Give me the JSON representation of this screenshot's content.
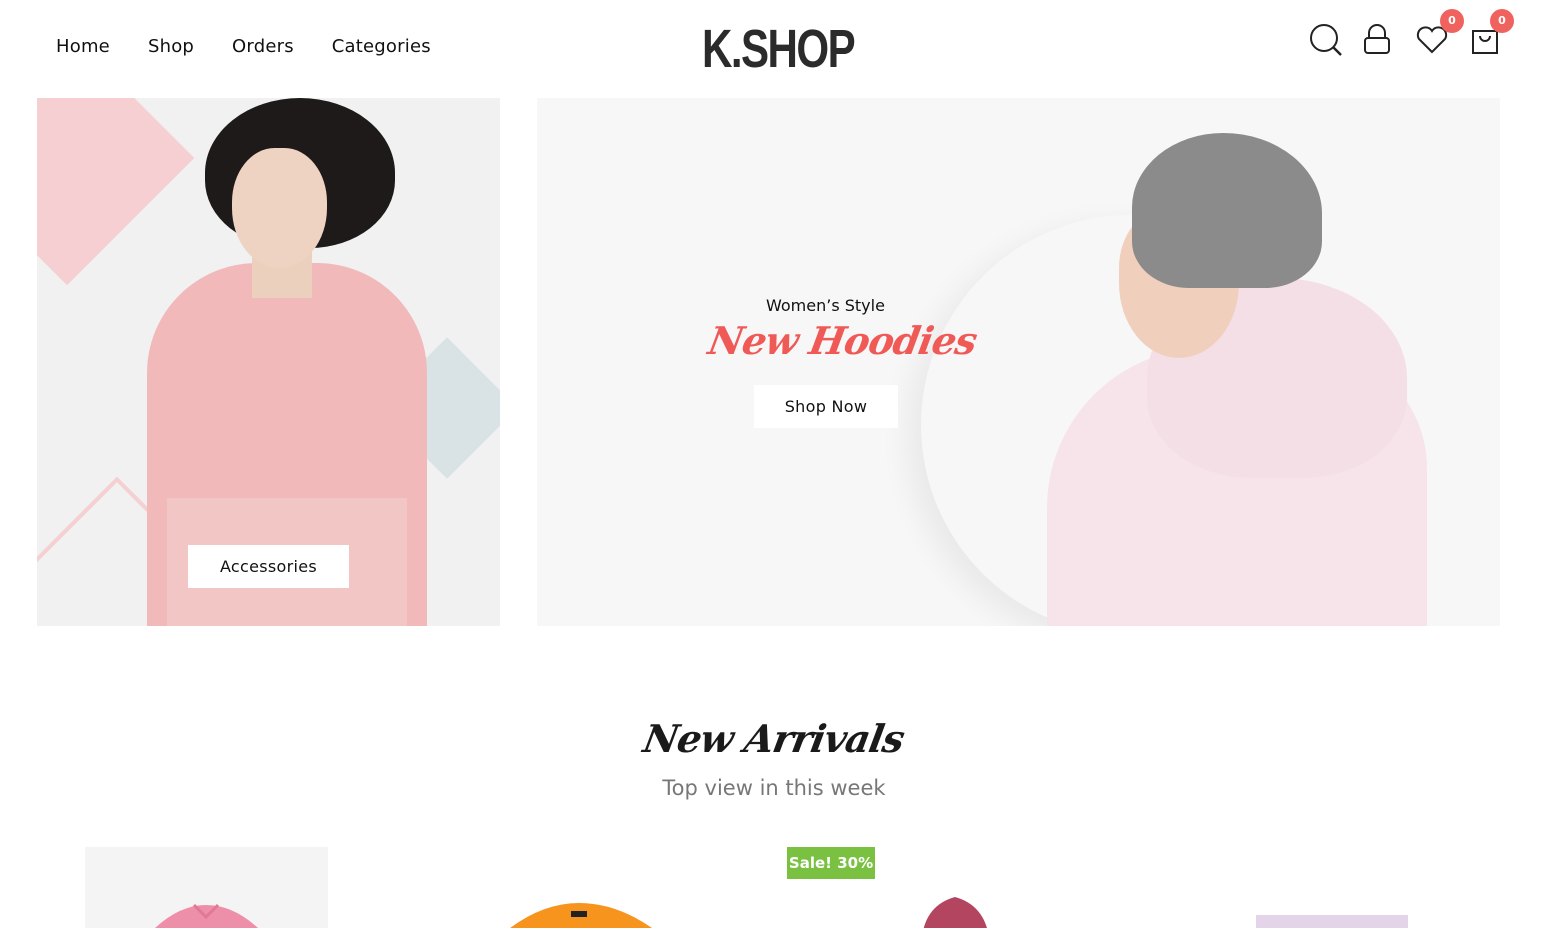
{
  "header": {
    "nav": [
      "Home",
      "Shop",
      "Orders",
      "Categories"
    ],
    "logo": "K.SHOP",
    "icons": [
      "search-icon",
      "lock-icon",
      "heart-icon",
      "bag-icon"
    ],
    "wishlist_count": "0",
    "cart_count": "0"
  },
  "banner_left": {
    "button_label": "Accessories"
  },
  "banner_right": {
    "subtitle": "Women’s Style",
    "title": "New Hoodies",
    "button_label": "Shop Now"
  },
  "new_arrivals": {
    "title": "New Arrivals",
    "subtitle": "Top view in this week",
    "sale_badge": "Sale! 30%"
  },
  "colors": {
    "accent": "#f0625e",
    "sale": "#7ac142",
    "text": "#111111",
    "muted": "#777777"
  }
}
